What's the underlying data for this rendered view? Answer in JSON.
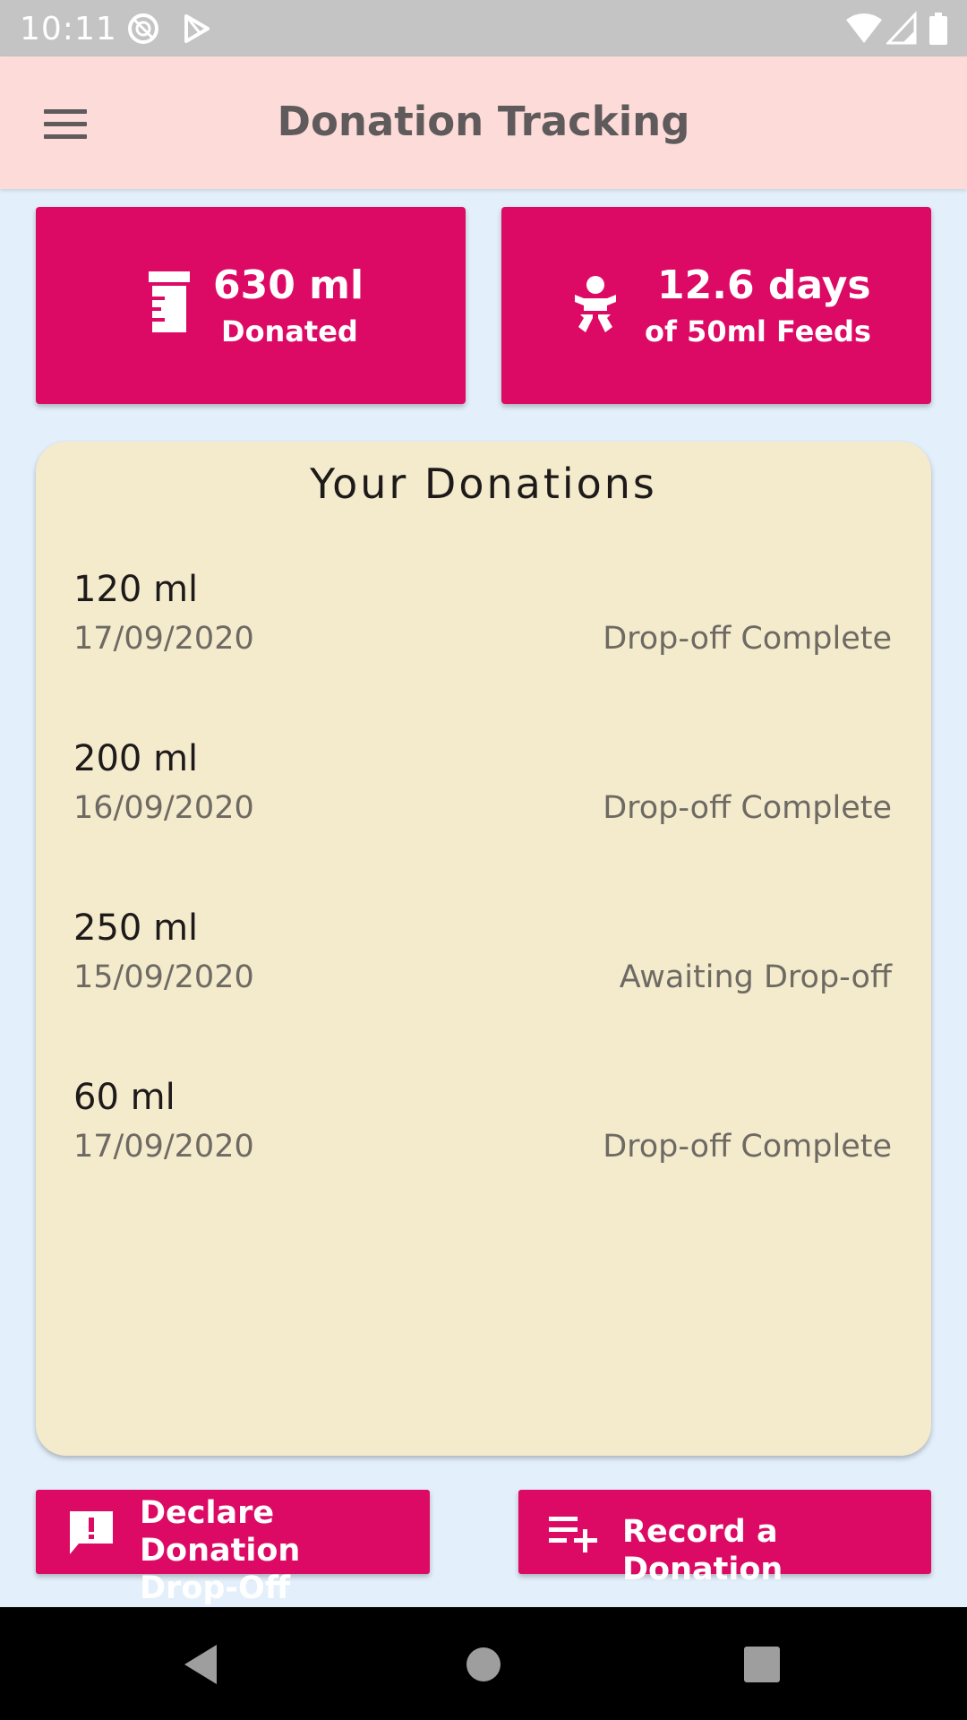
{
  "status_bar": {
    "time": "10:11",
    "icons": [
      "do-not-disturb-icon",
      "play-store-icon",
      "wifi-icon",
      "signal-icon",
      "battery-icon"
    ]
  },
  "app_bar": {
    "title": "Donation Tracking",
    "menu_icon": "hamburger-menu-icon"
  },
  "stats": {
    "donated": {
      "value": "630 ml",
      "label": "Donated",
      "icon": "milk-container-icon"
    },
    "feeds": {
      "value": "12.6 days",
      "label": "of 50ml Feeds",
      "icon": "baby-icon"
    }
  },
  "donations": {
    "title": "Your Donations",
    "items": [
      {
        "amount": "120 ml",
        "date": "17/09/2020",
        "status": "Drop-off Complete"
      },
      {
        "amount": "200 ml",
        "date": "16/09/2020",
        "status": "Drop-off Complete"
      },
      {
        "amount": "250 ml",
        "date": "15/09/2020",
        "status": "Awaiting Drop-off"
      },
      {
        "amount": "60 ml",
        "date": "17/09/2020",
        "status": "Drop-off Complete"
      }
    ]
  },
  "actions": {
    "declare": {
      "label_line1": "Declare Donation",
      "label_line2": "Drop-Off",
      "icon": "feedback-alert-icon"
    },
    "record": {
      "label": "Record a Donation",
      "icon": "playlist-add-icon"
    }
  },
  "nav_bar": {
    "icons": [
      "back-icon",
      "home-icon",
      "recents-icon"
    ]
  },
  "colors": {
    "accent": "#dc0a65",
    "app_bar": "#fddbd8",
    "background": "#e3effb",
    "panel": "#f4ebcd"
  }
}
